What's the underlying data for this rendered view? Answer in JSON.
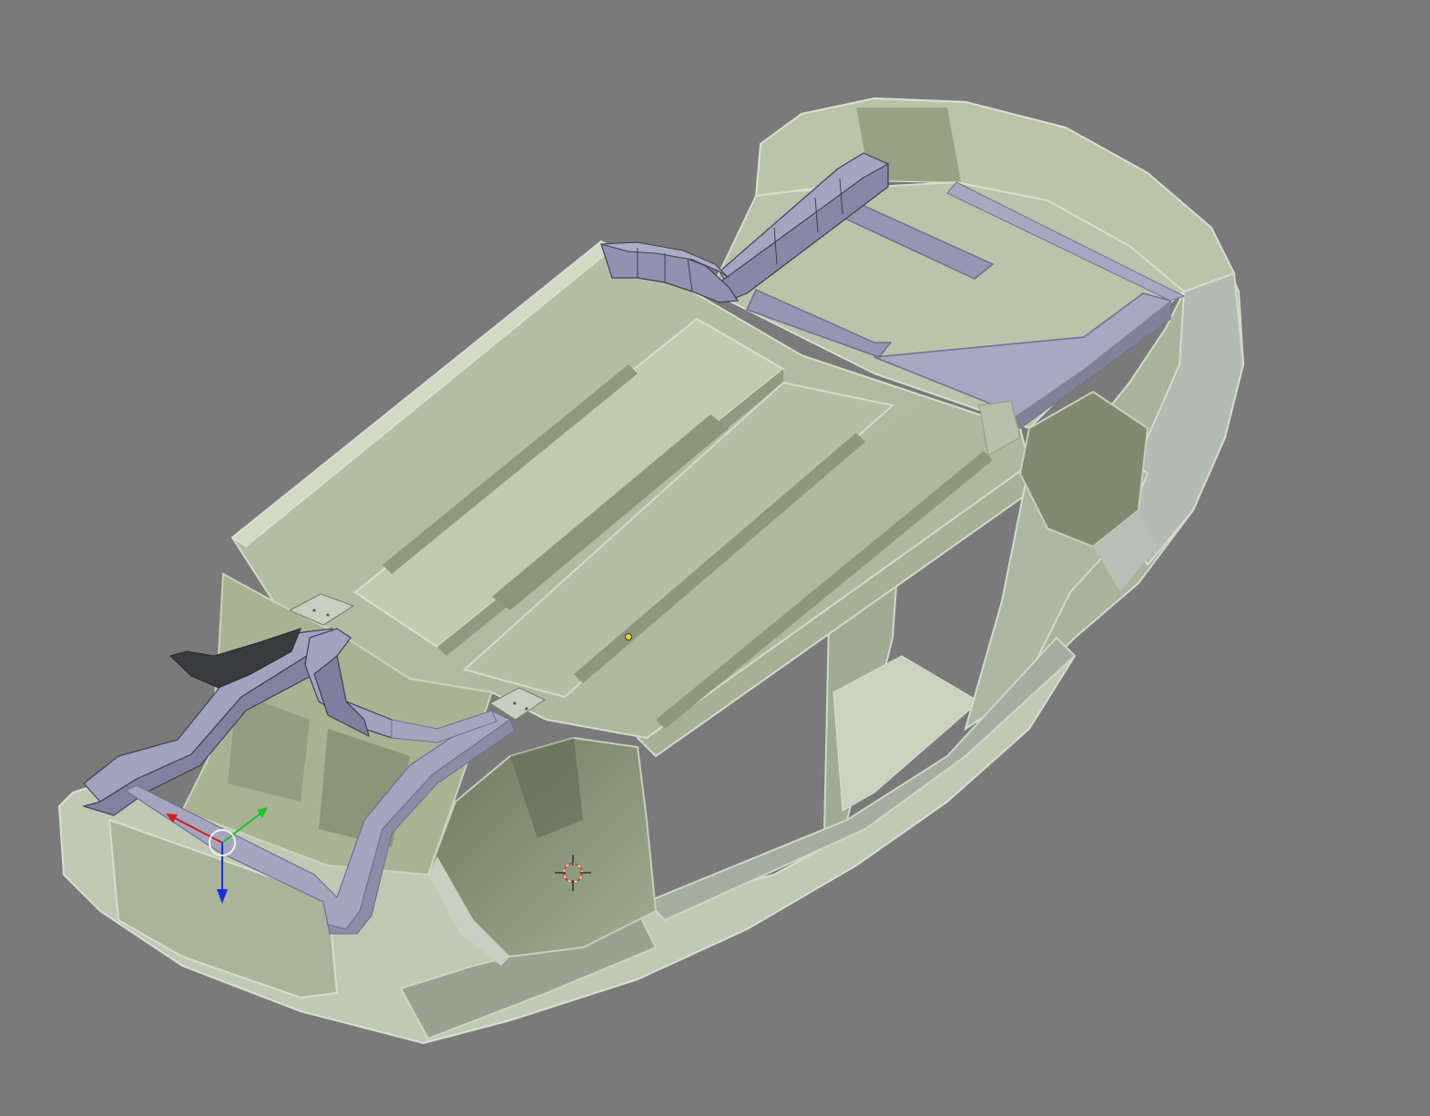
{
  "viewport": {
    "background": "#7a7a7a",
    "mode": "3d-viewport-edit-mode",
    "object": "car-body-mesh"
  },
  "colors": {
    "body_light": "#c4cfb8",
    "body_mid": "#aeb99e",
    "body_shadow": "#7f8a70",
    "body_dark": "#69745f",
    "body_edge": "#d7dfd0",
    "frame_light": "#a6a9c4",
    "frame_mid": "#9396b3",
    "frame_dark": "#6d708c",
    "frame_edge": "#3c3d4a",
    "bracket": "#3a3b3f",
    "axis_x": "#d21d1d",
    "axis_y": "#22c02a",
    "axis_z": "#1a32d8",
    "cursor_red": "#e23a2a",
    "origin_dot": "#f1d14a"
  },
  "icons": {
    "manipulator": "transform-gizmo-icon",
    "cursor": "3d-cursor-icon",
    "origin": "object-origin-icon"
  }
}
